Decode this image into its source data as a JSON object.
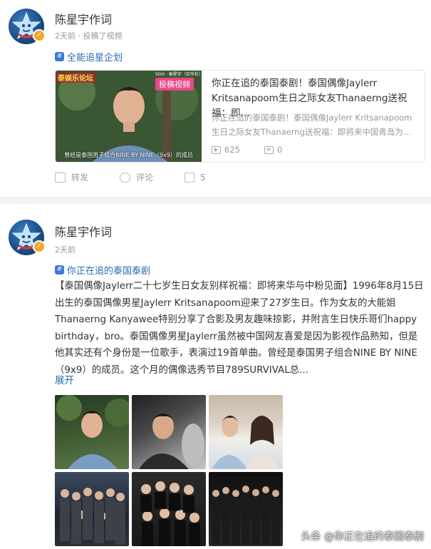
{
  "post1": {
    "author": "陈星宇作词",
    "meta": "2天前 · 投稿了视频",
    "topic": "全能追星企划",
    "card": {
      "title": "你正在追的泰国泰剧！泰国偶像Jaylerr Kritsanapoom生日之际女友Thanaerng送祝福：即...",
      "desc": "你正在追的泰国泰剧！泰国偶像Jaylerr Kritsanapoom生日之际女友Thanaerng送祝福：即将来中国青岛为...",
      "tag": "投稿视频",
      "tag_left": "泰娱乐论坛",
      "tag_small": "SGH · 泰星宇（合作社）",
      "caption": "曾经是泰国男子组合NINE BY NINE（9x9）的成员",
      "plays": "625",
      "comments": "0"
    },
    "actions": {
      "share": "转发",
      "comment": "评论",
      "like": "5"
    }
  },
  "post2": {
    "author": "陈星宇作词",
    "meta": "2天前",
    "topic": "你正在追的泰国泰剧",
    "body": "【泰国偶像Jaylerr二十七岁生日女友别样祝福：即将来华与中粉见面】1996年8月15日出生的泰国偶像男星Jaylerr Kritsanapoom迎来了27岁生日。作为女友的大能姐Thanaerng Kanyawee特别分享了合影及男友趣味掠影，并附言生日快乐哥们happy birthday，bro。泰国偶像男星Jaylerr虽然被中国网友喜爱是因为影视作品熟知，但是他其实还有个身份是一位歌手，表演过19首单曲。曾经是泰国男子组合NINE BY NINE（9x9）的成员。这个月的偶像选秀节目789SURVIVAL总...",
    "expand": "展开"
  },
  "watermark": "头条 @你正在追的泰国泰剧",
  "colors": {
    "link": "#2a6db0",
    "badge": "#f5a623",
    "video_tag": "#e8488a",
    "separator": "#f2f2f2"
  }
}
